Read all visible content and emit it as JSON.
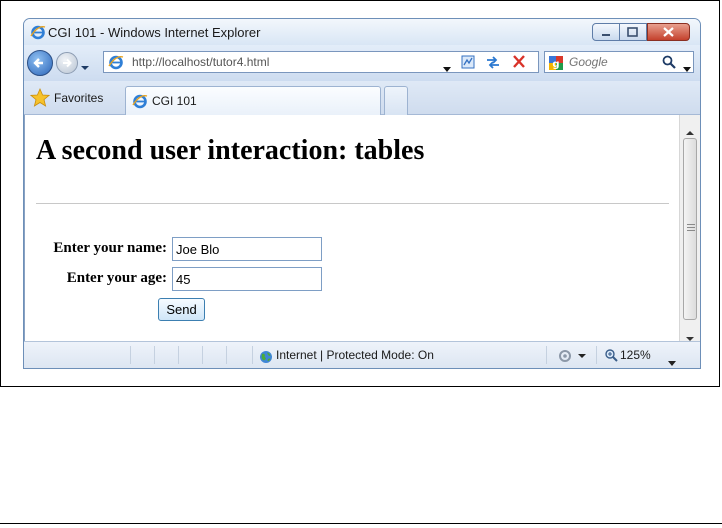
{
  "window": {
    "title": "CGI 101 - Windows Internet Explorer"
  },
  "nav": {
    "url": "http://localhost/tutor4.html",
    "search_placeholder": "Google"
  },
  "tabs": {
    "favorites_label": "Favorites",
    "active_tab_label": "CGI 101"
  },
  "page": {
    "heading": "A second user interaction: tables",
    "name_label": "Enter your name:",
    "name_value": "Joe Blo",
    "age_label": "Enter your age:",
    "age_value": "45",
    "send_label": "Send"
  },
  "status": {
    "zone_text": "Internet | Protected Mode: On",
    "zoom": "125%"
  },
  "colors": {
    "close_button": "#c4412d",
    "link_blue": "#2a64b8"
  },
  "icons": [
    "ie-icon",
    "back-arrow-icon",
    "forward-arrow-icon",
    "refresh-icon",
    "stop-icon",
    "google-icon",
    "search-icon",
    "star-icon",
    "globe-icon",
    "zoom-icon"
  ]
}
